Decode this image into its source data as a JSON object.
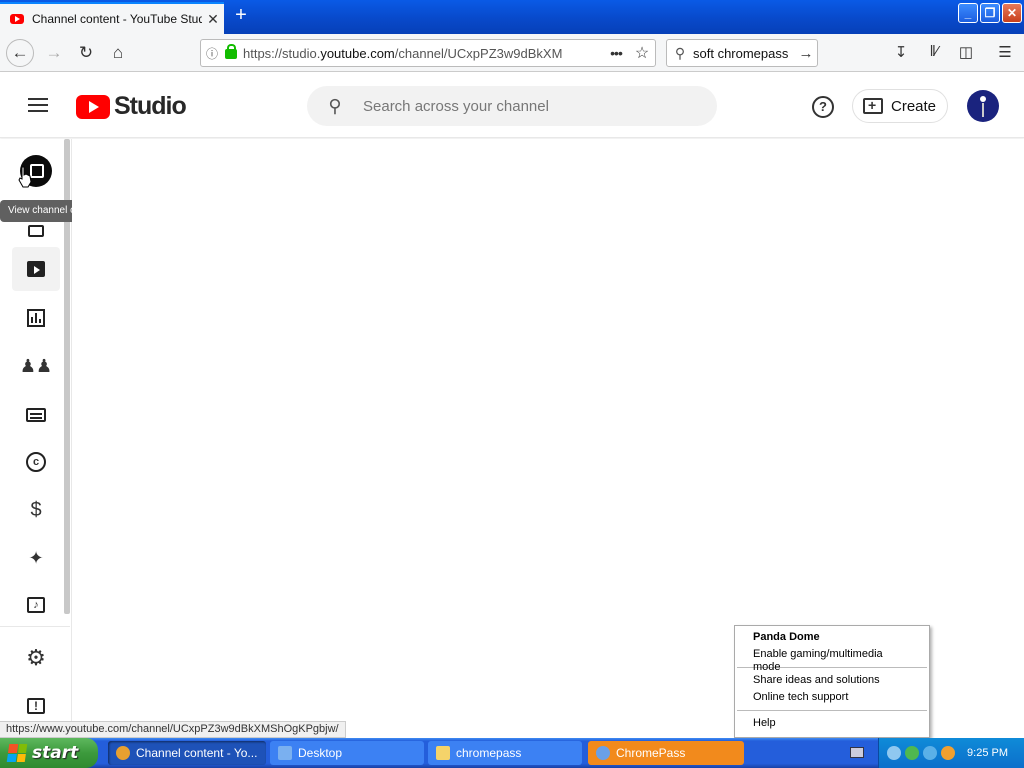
{
  "browser": {
    "tab_title": "Channel content - YouTube Studio",
    "tab_close": "✕",
    "new_tab": "+",
    "url_prefix": "https://studio.",
    "url_host": "youtube.com",
    "url_path": "/channel/UCxpPZ3w9dBkXM",
    "search_query": "soft chromepass",
    "window_buttons": [
      "_",
      "❐",
      "✕"
    ]
  },
  "studio": {
    "logo_text": "Studio",
    "search_placeholder": "Search across your channel",
    "create_label": "Create",
    "help_label": "?"
  },
  "sidebar": {
    "tooltip": "View channel on YouTube",
    "items": [
      "dashboard",
      "content",
      "analytics",
      "comments",
      "subtitles",
      "copyright",
      "earn",
      "customization",
      "audio-library",
      "settings",
      "feedback"
    ]
  },
  "status_url": "https://www.youtube.com/channel/UCxpPZ3w9dBkXMShOgKPgbjw/",
  "context_menu": {
    "title": "Panda Dome",
    "items": [
      "Enable gaming/multimedia mode",
      "Share ideas and solutions",
      "Online tech support",
      "Help"
    ]
  },
  "taskbar": {
    "start_label": "start",
    "tasks": [
      "Channel content - Yo...",
      "Desktop",
      "chromepass",
      "ChromePass"
    ],
    "clock": "9:25 PM"
  },
  "colors": {
    "youtube_red": "#ff0000",
    "xp_blue": "#245edb",
    "xp_green": "#3c9a3c",
    "active_task_orange": "#f28a1c"
  }
}
